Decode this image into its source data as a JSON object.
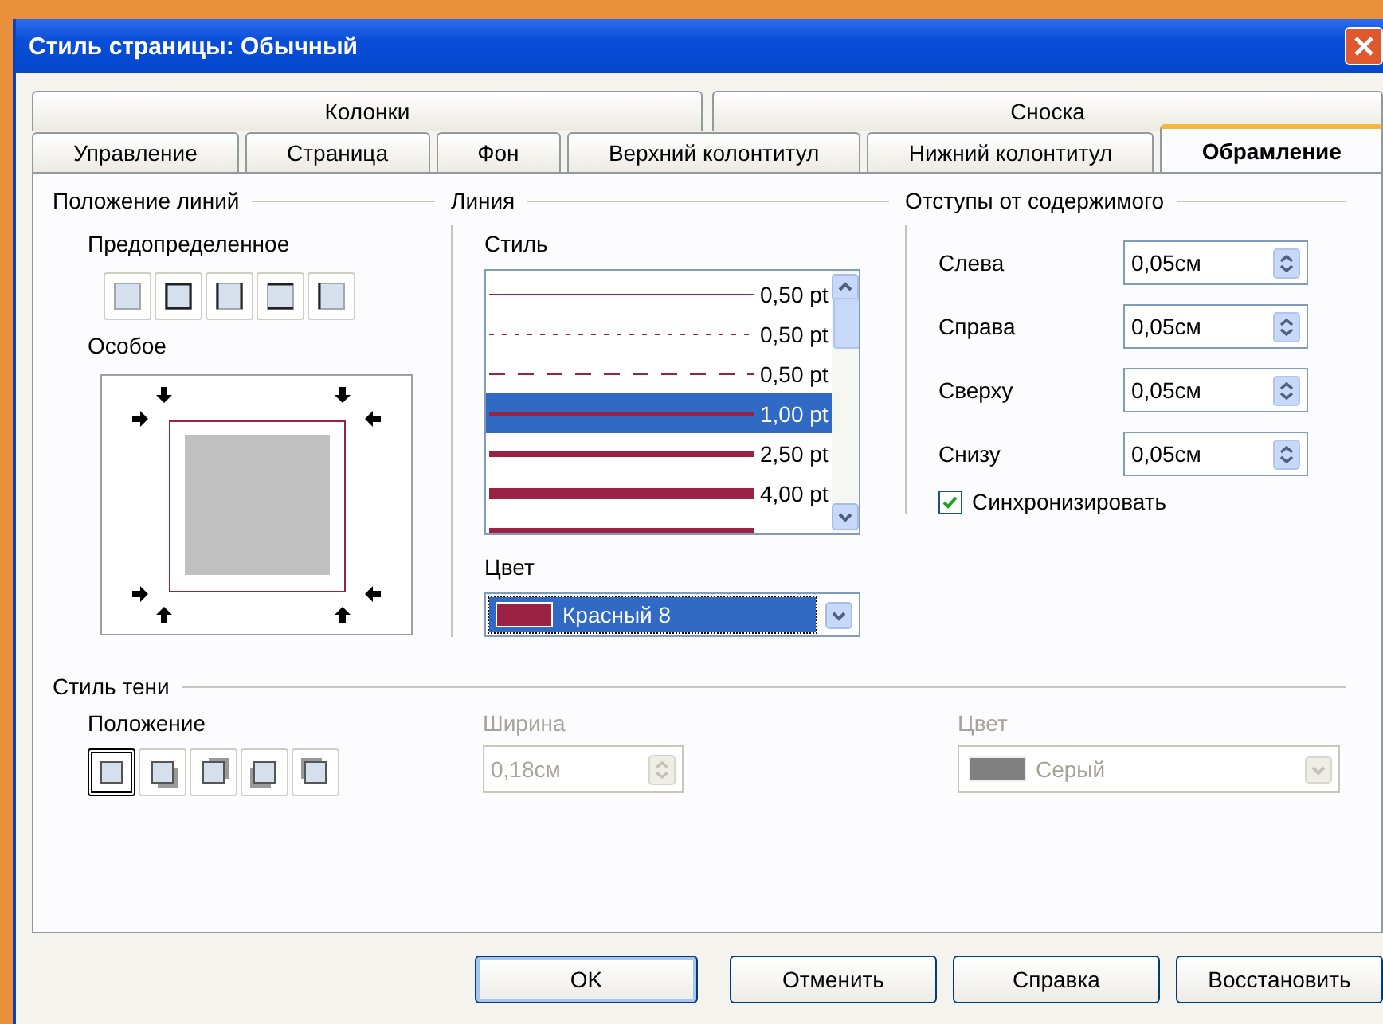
{
  "window": {
    "title": "Стиль страницы: Обычный"
  },
  "tabs_top": [
    {
      "label": "Колонки",
      "selected": false
    },
    {
      "label": "Сноска",
      "selected": false
    }
  ],
  "tabs": [
    {
      "label": "Управление",
      "selected": false
    },
    {
      "label": "Страница",
      "selected": false
    },
    {
      "label": "Фон",
      "selected": false
    },
    {
      "label": "Верхний колонтитул",
      "selected": false
    },
    {
      "label": "Нижний колонтитул",
      "selected": false
    },
    {
      "label": "Обрамление",
      "selected": true
    }
  ],
  "line_arrangement": {
    "title": "Положение линий",
    "default_label": "Предопределенное",
    "presets": [
      {
        "kind": "none",
        "selected": false
      },
      {
        "kind": "all",
        "selected": false
      },
      {
        "kind": "left-right",
        "selected": false
      },
      {
        "kind": "top-bottom",
        "selected": false
      },
      {
        "kind": "left",
        "selected": false
      }
    ],
    "user_defined_label": "Особое"
  },
  "line": {
    "title": "Линия",
    "style_label": "Стиль",
    "styles": [
      {
        "kind": "thin",
        "label": "0,50 pt",
        "selected": false
      },
      {
        "kind": "dotted",
        "label": "0,50 pt",
        "selected": false
      },
      {
        "kind": "dashed",
        "label": "0,50 pt",
        "selected": false
      },
      {
        "kind": "medium",
        "label": "1,00 pt",
        "selected": true
      },
      {
        "kind": "thick",
        "label": "2,50 pt",
        "selected": false
      },
      {
        "kind": "heavy",
        "label": "4,00 pt",
        "selected": false
      },
      {
        "kind": "heavy",
        "selected": false
      }
    ],
    "color_label": "Цвет",
    "color": {
      "value": "Красный 8",
      "color": "#9b2245"
    }
  },
  "spacing": {
    "title": "Отступы от содержимого",
    "fields": [
      {
        "label": "Слева",
        "value": "0,05см"
      },
      {
        "label": "Справа",
        "value": "0,05см"
      },
      {
        "label": "Сверху",
        "value": "0,05см"
      },
      {
        "label": "Снизу",
        "value": "0,05см"
      }
    ],
    "synchronize": {
      "label": "Синхронизировать",
      "checked": true
    }
  },
  "shadow": {
    "title": "Стиль тени",
    "position_label": "Положение",
    "positions": [
      {
        "kind": "none",
        "selected": true
      },
      {
        "kind": "bottom-right",
        "selected": false
      },
      {
        "kind": "top-right",
        "selected": false
      },
      {
        "kind": "bottom-left",
        "selected": false
      },
      {
        "kind": "top-left",
        "selected": false
      }
    ],
    "width_label": "Ширина",
    "width": "0,18см",
    "color_label": "Цвет",
    "color": {
      "value": "Серый",
      "color": "#808080"
    },
    "disabled": true
  },
  "buttons": [
    {
      "label": "OK",
      "kind": "default"
    },
    {
      "label": "Отменить",
      "kind": "normal"
    },
    {
      "label": "Справка",
      "kind": "normal"
    },
    {
      "label": "Восстановить",
      "kind": "normal"
    }
  ]
}
